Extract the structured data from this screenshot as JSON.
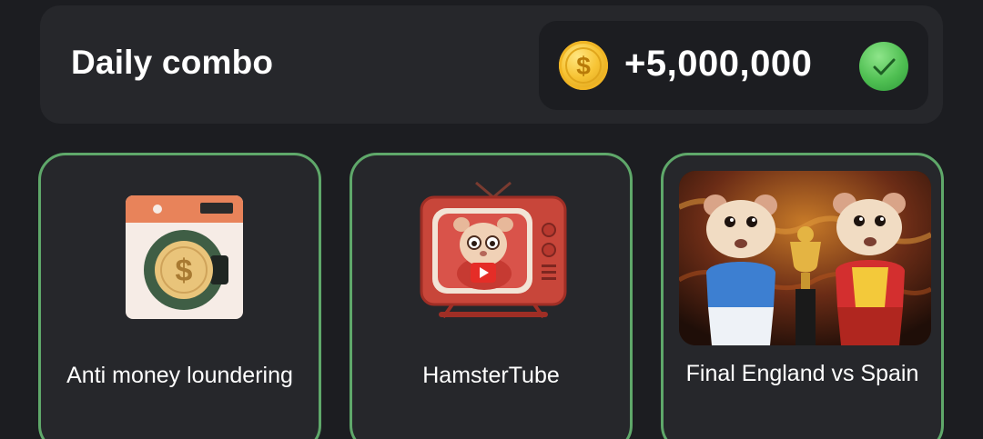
{
  "header": {
    "title": "Daily combo",
    "reward_amount": "+5,000,000",
    "coin_icon": "dollar-coin-icon",
    "status_icon": "checkmark-icon",
    "colors": {
      "coin": "#f7c435",
      "check": "#4fbf52",
      "card_border": "#5fa86a"
    }
  },
  "cards": [
    {
      "label": "Anti money loundering",
      "icon": "washing-machine-coin-icon"
    },
    {
      "label": "HamsterTube",
      "icon": "retro-tv-hamster-icon"
    },
    {
      "label": "Final England vs Spain",
      "icon": "hamsters-trophy-image"
    }
  ]
}
